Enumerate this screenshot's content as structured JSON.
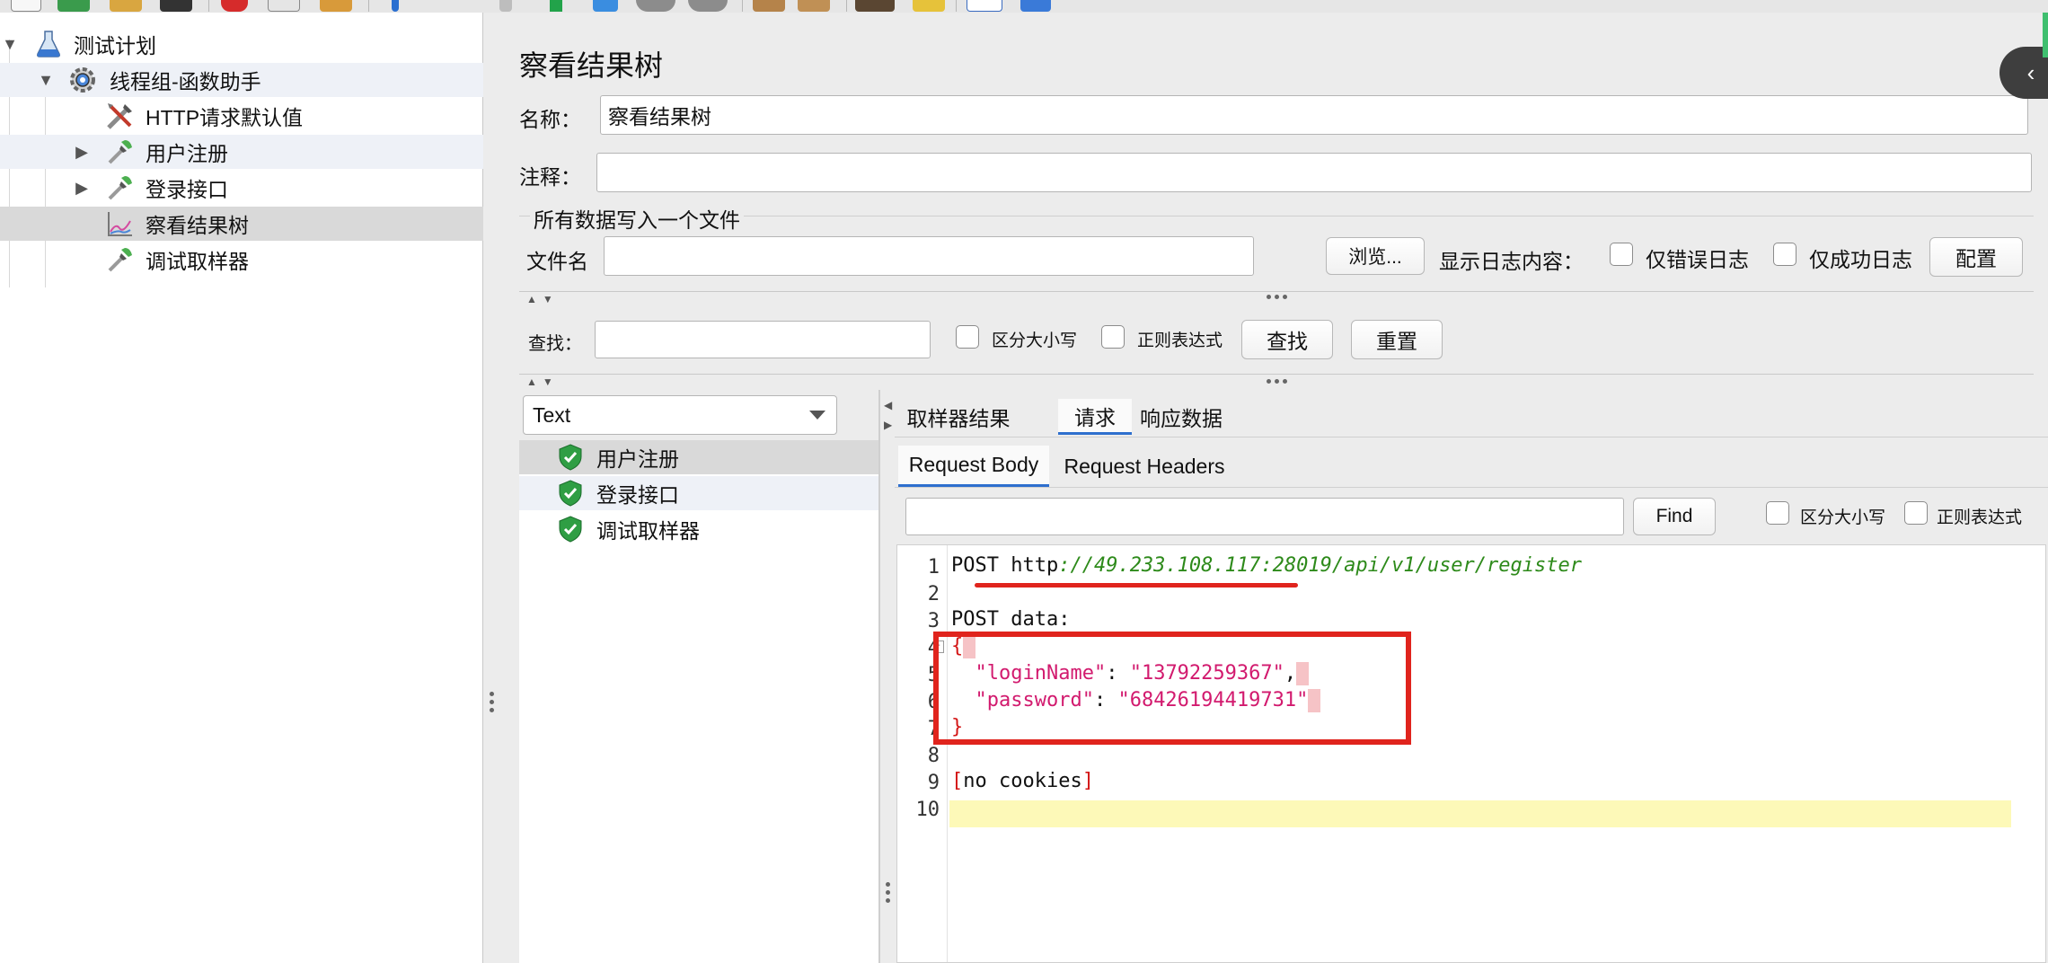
{
  "toolbar": {
    "icons": [
      "new-icon",
      "templates-icon",
      "open-icon",
      "save-icon",
      "cut-icon",
      "copy-icon",
      "paste-icon",
      "expand-icon",
      "toggle-icon",
      "start-icon",
      "start-no-pause-icon",
      "stop-icon",
      "shutdown-icon",
      "clear-icon",
      "clear-all-icon",
      "search-icon",
      "reset-search-icon",
      "function-helper-icon",
      "help-icon"
    ]
  },
  "tree": {
    "items": [
      {
        "label": "测试计划",
        "icon": "test-plan-flask-icon"
      },
      {
        "label": "线程组-函数助手",
        "icon": "thread-group-gear-icon"
      },
      {
        "label": "HTTP请求默认值",
        "icon": "config-tools-icon"
      },
      {
        "label": "用户注册",
        "icon": "sampler-pipette-icon"
      },
      {
        "label": "登录接口",
        "icon": "sampler-pipette-icon"
      },
      {
        "label": "察看结果树",
        "icon": "listener-graph-icon"
      },
      {
        "label": "调试取样器",
        "icon": "sampler-pipette-icon"
      }
    ]
  },
  "panel": {
    "title": "察看结果树",
    "name_label": "名称：",
    "name_value": "察看结果树",
    "comment_label": "注释：",
    "comment_value": "",
    "file_section_title": "所有数据写入一个文件",
    "filename_label": "文件名",
    "filename_value": "",
    "browse_button": "浏览...",
    "log_display_label": "显示日志内容：",
    "errors_only_label": "仅错误日志",
    "success_only_label": "仅成功日志",
    "configure_button": "配置"
  },
  "search": {
    "label": "查找：",
    "value": "",
    "case_sensitive_label": "区分大小写",
    "regex_label": "正则表达式",
    "find_button": "查找",
    "reset_button": "重置"
  },
  "renderer": {
    "selected": "Text"
  },
  "results": [
    {
      "label": "用户注册",
      "status": "success"
    },
    {
      "label": "登录接口",
      "status": "success"
    },
    {
      "label": "调试取样器",
      "status": "success"
    }
  ],
  "detail_tabs": [
    "取样器结果",
    "请求",
    "响应数据"
  ],
  "active_detail_tab": "请求",
  "request_tabs": [
    "Request Body",
    "Request Headers"
  ],
  "active_request_tab": "Request Body",
  "body_search": {
    "value": "",
    "find_button": "Find",
    "case_sensitive_label": "区分大小写",
    "regex_label": "正则表达式"
  },
  "code": {
    "line_numbers": [
      "1",
      "2",
      "3",
      "4",
      "5",
      "6",
      "7",
      "8",
      "9",
      "10"
    ],
    "method": "POST ",
    "url_scheme": "http",
    "url_rest": "://49.233.108.117:28019/api/v1/user/register",
    "post_data_label": "POST data:",
    "open_brace": "{",
    "key1": "\"loginName\"",
    "sep1": ": ",
    "val1": "\"13792259367\"",
    "comma": ",",
    "key2": "\"password\"",
    "sep2": ": ",
    "val2": "\"68426194419731\"",
    "close_brace": "}",
    "cookies_open": "[",
    "cookies_text": "no cookies",
    "cookies_close": "]"
  },
  "colors": {
    "annotation_red": "#e0241d",
    "success_green": "#2f9e44",
    "tab_accent": "#2e6fce",
    "current_line_highlight": "#fdf9b8"
  }
}
